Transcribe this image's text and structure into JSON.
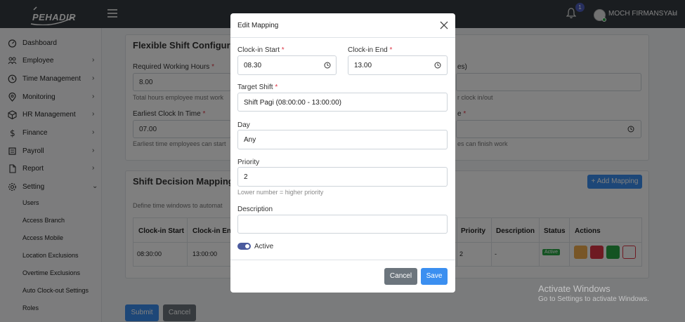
{
  "topbar": {
    "logo_text": "PEHADIR",
    "notification_count": "1",
    "user_name": "MOCH FIRMANSYAH",
    "user_caret": "⌄"
  },
  "sidebar": {
    "items": [
      {
        "label": "Dashboard",
        "icon": "dashboard-icon",
        "caret": ""
      },
      {
        "label": "Employee",
        "icon": "users-icon",
        "caret": "›"
      },
      {
        "label": "Time Management",
        "icon": "clock-icon",
        "caret": "›"
      },
      {
        "label": "Monitoring",
        "icon": "location-pin-icon",
        "caret": "›"
      },
      {
        "label": "HR Management",
        "icon": "cube-icon",
        "caret": "›"
      },
      {
        "label": "Finance",
        "icon": "dollar-icon",
        "caret": "›"
      },
      {
        "label": "Payroll",
        "icon": "wallet-icon",
        "caret": "›"
      },
      {
        "label": "Report",
        "icon": "file-icon",
        "caret": "›"
      },
      {
        "label": "Setting",
        "icon": "gear-icon",
        "caret": "⌄"
      }
    ],
    "sub_items": [
      "Users",
      "Access Branch",
      "Access Mobile",
      "Location Exclusions",
      "Overtime Exclusions",
      "Auto Clock-out Settings",
      "Roles"
    ]
  },
  "flexible": {
    "title": "Flexible Shift Configurat",
    "req_hours_label": "Required Working Hours",
    "req_hours_value": "8.00",
    "req_hours_help": "Total hours employee must work",
    "right_label_fragment": "es)",
    "right_help_fragment": "r clock in/out",
    "earliest_label": "Earliest Clock In Time",
    "earliest_value": "07.00",
    "earliest_help": "Earliest time employees can start",
    "right_label2_fragment": "e",
    "right_help2_fragment": "es can finish work"
  },
  "mappings": {
    "title": "Shift Decision Mappings",
    "add_button": "+ Add Mapping",
    "description": "Define time windows to automat",
    "headers": {
      "start": "Clock-in Start",
      "end": "Clock-in End",
      "priority": "Priority",
      "description": "Description",
      "status": "Status",
      "actions": "Actions"
    },
    "row": {
      "start": "08:30:00",
      "end": "13:00:00",
      "priority": "2",
      "description": "-",
      "status": "Active"
    }
  },
  "page_buttons": {
    "submit": "Submit",
    "cancel": "Cancel"
  },
  "modal": {
    "title": "Edit Mapping",
    "clock_in_start_label": "Clock-in Start",
    "clock_in_start_value": "08.30",
    "clock_in_end_label": "Clock-in End",
    "clock_in_end_value": "13.00",
    "target_shift_label": "Target Shift",
    "target_shift_value": "Shift Pagi (08:00:00 - 13:00:00)",
    "day_label": "Day",
    "day_value": "Any",
    "priority_label": "Priority",
    "priority_value": "2",
    "priority_help": "Lower number = higher priority",
    "description_label": "Description",
    "description_value": "",
    "active_label": "Active",
    "cancel_button": "Cancel",
    "save_button": "Save",
    "required_mark": "*"
  },
  "watermark": {
    "title": "Activate Windows",
    "subtitle": "Go to Settings to activate Windows."
  },
  "colors": {
    "topbar": "#343a40",
    "primary": "#3b8ff0",
    "secondary": "#6c757d",
    "accent": "#4a5a9e",
    "success": "#28a745",
    "danger": "#dc3545",
    "warning": "#f0ad4e"
  }
}
